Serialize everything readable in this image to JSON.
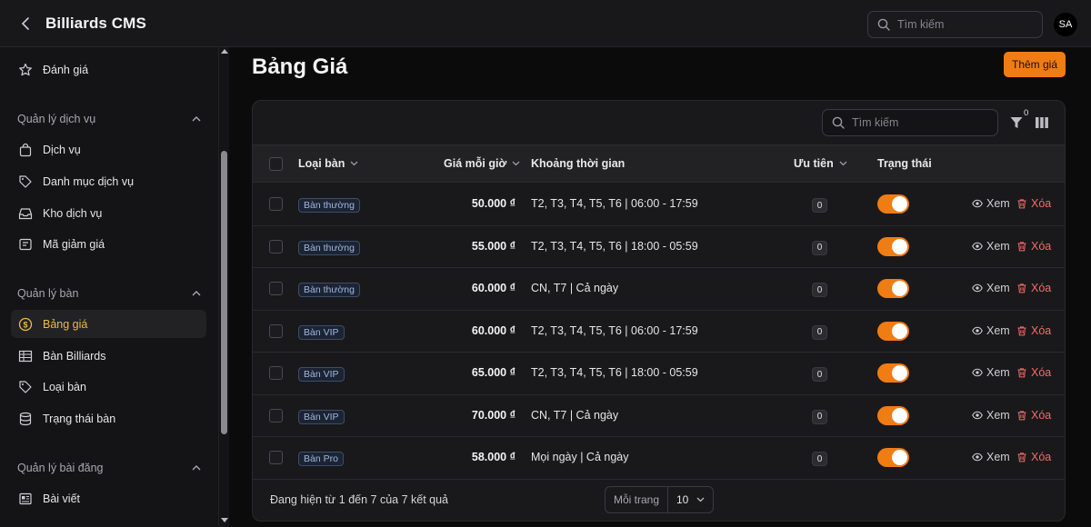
{
  "app": {
    "title": "Billiards CMS",
    "search_placeholder": "Tìm kiếm",
    "avatar_initials": "SA"
  },
  "sidebar": {
    "top_item": "Đánh giá",
    "groups": [
      {
        "label": "Quản lý dịch vụ",
        "items": [
          "Dịch vụ",
          "Danh mục dịch vụ",
          "Kho dịch vụ",
          "Mã giảm giá"
        ]
      },
      {
        "label": "Quản lý bàn",
        "items": [
          "Bảng giá",
          "Bàn Billiards",
          "Loại bàn",
          "Trạng thái bàn"
        ]
      },
      {
        "label": "Quản lý bài đăng",
        "items": [
          "Bài viết"
        ]
      }
    ],
    "active_item": "Bảng giá"
  },
  "page": {
    "title": "Bảng Giá",
    "add_button": "Thêm giá"
  },
  "table": {
    "search_placeholder": "Tìm kiếm",
    "filter_count": "0",
    "columns": {
      "type": "Loại bàn",
      "price": "Giá mỗi giờ",
      "period": "Khoảng thời gian",
      "priority": "Ưu tiên",
      "status": "Trạng thái"
    },
    "view_label": "Xem",
    "delete_label": "Xóa",
    "rows": [
      {
        "type": "Bàn thường",
        "price": "50.000 ₫",
        "period": "T2, T3, T4, T5, T6 | 06:00 - 17:59",
        "priority": "0",
        "active": true
      },
      {
        "type": "Bàn thường",
        "price": "55.000 ₫",
        "period": "T2, T3, T4, T5, T6 | 18:00 - 05:59",
        "priority": "0",
        "active": true
      },
      {
        "type": "Bàn thường",
        "price": "60.000 ₫",
        "period": "CN, T7 | Cả ngày",
        "priority": "0",
        "active": true
      },
      {
        "type": "Bàn VIP",
        "price": "60.000 ₫",
        "period": "T2, T3, T4, T5, T6 | 06:00 - 17:59",
        "priority": "0",
        "active": true
      },
      {
        "type": "Bàn VIP",
        "price": "65.000 ₫",
        "period": "T2, T3, T4, T5, T6 | 18:00 - 05:59",
        "priority": "0",
        "active": true
      },
      {
        "type": "Bàn VIP",
        "price": "70.000 ₫",
        "period": "CN, T7 | Cả ngày",
        "priority": "0",
        "active": true
      },
      {
        "type": "Bàn Pro",
        "price": "58.000 ₫",
        "period": "Mọi ngày | Cả ngày",
        "priority": "0",
        "active": true
      }
    ],
    "footer": {
      "summary": "Đang hiện từ 1 đến 7 của 7 kết quả",
      "per_page_label": "Mỗi trang",
      "per_page_value": "10"
    }
  },
  "colors": {
    "accent": "#f07c14",
    "active_nav": "#f0b84a",
    "delete": "#f26b6b"
  }
}
